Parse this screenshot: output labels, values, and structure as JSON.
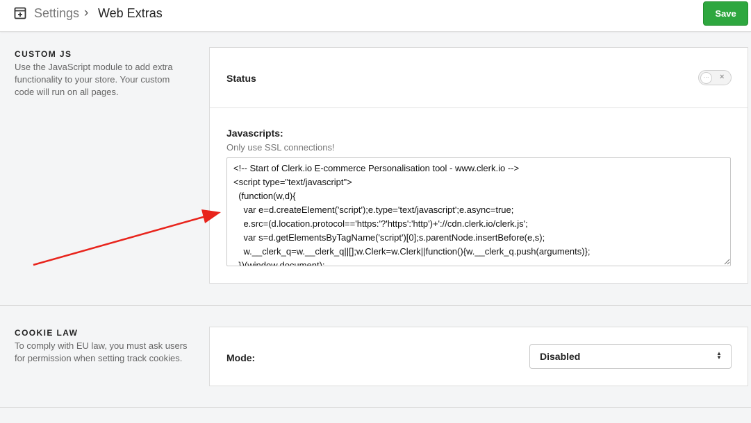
{
  "header": {
    "breadcrumb_root": "Settings",
    "breadcrumb_separator": "›",
    "breadcrumb_current": "Web Extras",
    "save_label": "Save",
    "icon": "settings-page-icon"
  },
  "custom_js": {
    "title": "CUSTOM JS",
    "description": "Use the JavaScript module to add extra functionality to your store. Your custom code will run on all pages.",
    "status_label": "Status",
    "status_enabled": false,
    "toggle_off_glyph": "×",
    "javascripts_label": "Javascripts:",
    "hint": "Only use SSL connections!",
    "code": "<!-- Start of Clerk.io E-commerce Personalisation tool - www.clerk.io -->\n<script type=\"text/javascript\">\n  (function(w,d){\n    var e=d.createElement('script');e.type='text/javascript';e.async=true;\n    e.src=(d.location.protocol=='https:'?'https':'http')+'://cdn.clerk.io/clerk.js';\n    var s=d.getElementsByTagName('script')[0];s.parentNode.insertBefore(e,s);\n    w.__clerk_q=w.__clerk_q||[];w.Clerk=w.Clerk||function(){w.__clerk_q.push(arguments)};\n  })(window,document);"
  },
  "cookie_law": {
    "title": "COOKIE LAW",
    "description": "To comply with EU law, you must ask users for permission when setting track cookies.",
    "mode_label": "Mode:",
    "mode_value": "Disabled"
  },
  "colors": {
    "save_button": "#2ea73f",
    "annotation_arrow": "#e8241c"
  }
}
